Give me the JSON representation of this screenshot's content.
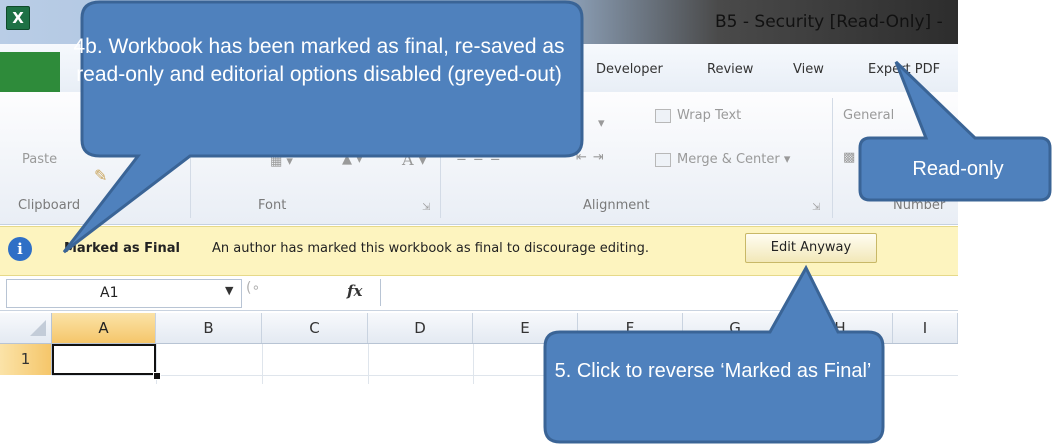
{
  "window": {
    "title": "B5 - Security  [Read-Only] -"
  },
  "ribbon": {
    "tabs": [
      "Developer",
      "Review",
      "View",
      "Expert PDF"
    ],
    "groups": {
      "clipboard": {
        "label": "Clipboard",
        "paste_label": "Paste"
      },
      "font": {
        "label": "Font"
      },
      "alignment": {
        "label": "Alignment",
        "wrap_text": "Wrap Text",
        "merge_center": "Merge & Center"
      },
      "number": {
        "label": "Number",
        "format_value": "General"
      }
    }
  },
  "message_bar": {
    "title": "Marked as Final",
    "text": "An author has marked this workbook as final to discourage editing.",
    "button": "Edit Anyway"
  },
  "formula_bar": {
    "name_box": "A1",
    "fx_label": "fx",
    "formula": ""
  },
  "sheet": {
    "columns": [
      "A",
      "B",
      "C",
      "D",
      "E",
      "F",
      "G",
      "H",
      "I"
    ],
    "rows": [
      "1"
    ],
    "selected_cell": "A1"
  },
  "callouts": {
    "workbook_final": "4b. Workbook has been marked as final, re-saved as read-only and editorial options disabled (greyed-out)",
    "read_only": "Read-only",
    "click_reverse": "5. Click to reverse ‘Marked as Final’"
  },
  "colors": {
    "callout_fill": "#4f81bd",
    "callout_border": "#3a6496",
    "message_bar": "#fdf4bf",
    "selected_header": "#f5c66a",
    "excel_green": "#1e7145"
  },
  "icons": {
    "app": "excel-icon",
    "message": "info-icon",
    "fx": "function-icon"
  }
}
